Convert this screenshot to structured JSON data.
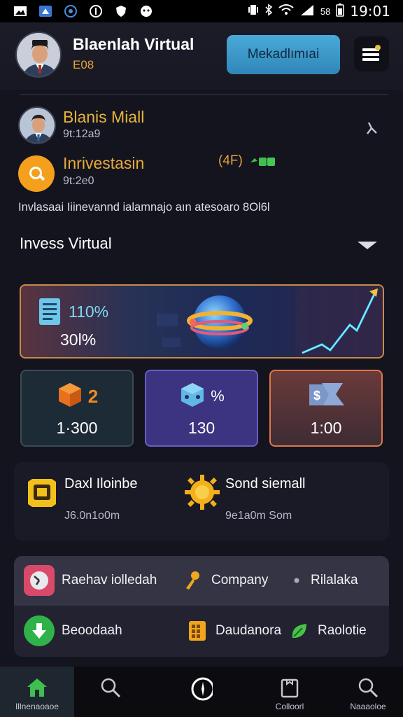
{
  "status_bar": {
    "time": "19:01",
    "battery_text": "58"
  },
  "header": {
    "name": "Blaenlah Virtual",
    "code": "E08",
    "button_label": "Mekadlımıai"
  },
  "profile": {
    "name": "Blanis Miall",
    "id": "9t:12a9"
  },
  "investment": {
    "title": "Inrivestasin",
    "id": "9t:2e0",
    "badge": "(4F)",
    "description": "Invlasaai Iiinevannd ialamnajo aın  atesoaro 8Ol6l"
  },
  "section": {
    "title": "Invess Virtual"
  },
  "banner": {
    "rate": "110%",
    "sub": "30l%"
  },
  "cards": [
    {
      "top_text": "2",
      "value": "1·300",
      "accent": "#f08a2a"
    },
    {
      "top_text": "%",
      "value": "130",
      "accent": "#7fd0f0"
    },
    {
      "top_text": "",
      "value": "1:00",
      "accent": "#8aa6d8"
    }
  ],
  "features": [
    {
      "title": "Daxl Iloinbe",
      "sub": "J6.0n1o0m"
    },
    {
      "title": "Sond siemall",
      "sub": "9e1a0m Som"
    }
  ],
  "menu": {
    "row1": [
      {
        "label": "Raehav iolledah"
      },
      {
        "label": "Company"
      },
      {
        "label": "Rilalaka"
      }
    ],
    "row2": [
      {
        "label": "Beoodaah"
      },
      {
        "label": "Daudanora"
      },
      {
        "label": "Raolotie"
      }
    ]
  },
  "nav": {
    "home_label": "Illnenaoaoe",
    "item4_label": "Colloorl",
    "item5_label": "Naaaoloe"
  },
  "colors": {
    "background": "#14141f",
    "accent_gold": "#e8b53c",
    "accent_blue": "#4aa9d8",
    "green": "#33b04a"
  }
}
